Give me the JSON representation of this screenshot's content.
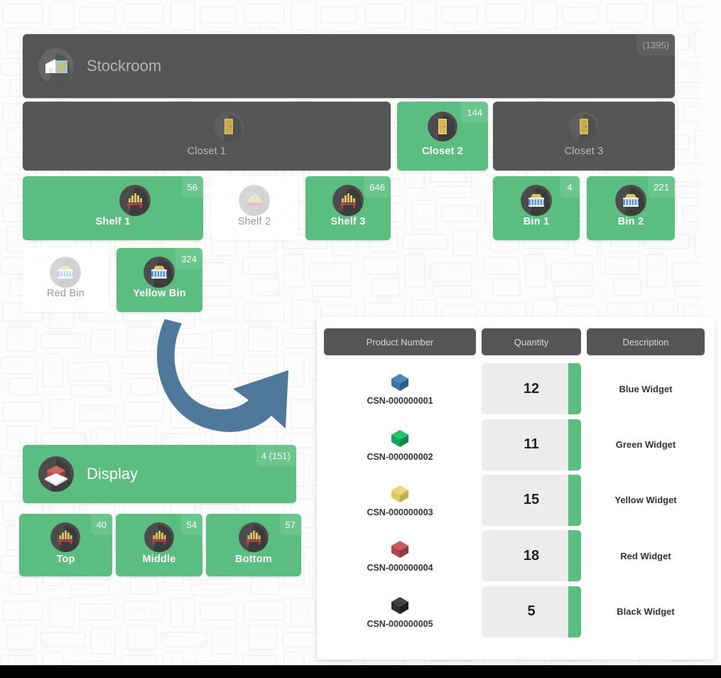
{
  "background": {
    "texture": "light-brick-pattern",
    "base_color": "#fcfcfc"
  },
  "colors": {
    "green": "#5cbd81",
    "green_badge": "#6ac68d",
    "dark": "#555555",
    "dark_badge": "#5f5f5f",
    "panel_white": "#ffffff",
    "qty_cell": "#ececec",
    "arrow_blue": "#4f7fa0"
  },
  "stockroom": {
    "title": "Stockroom",
    "badge": "(1395)",
    "icon": "warehouse-icon",
    "state": "inactive"
  },
  "closets": [
    {
      "label": "Closet 1",
      "badge": "",
      "icon": "closet-door-icon",
      "state": "inactive"
    },
    {
      "label": "Closet 2",
      "badge": "144",
      "icon": "closet-door-icon",
      "state": "active"
    },
    {
      "label": "Closet 3",
      "badge": "",
      "icon": "closet-door-icon",
      "state": "inactive"
    }
  ],
  "shelves": [
    {
      "label": "Shelf 1",
      "badge": "56",
      "icon": "shelf-icon",
      "state": "active"
    },
    {
      "label": "Shelf 2",
      "badge": "",
      "icon": "shelf-icon",
      "state": "empty"
    },
    {
      "label": "Shelf 3",
      "badge": "646",
      "icon": "shelf-icon",
      "state": "active"
    }
  ],
  "bins_top": [
    {
      "label": "Bin 1",
      "badge": "4",
      "icon": "bin-icon",
      "state": "active"
    },
    {
      "label": "Bin 2",
      "badge": "221",
      "icon": "bin-icon",
      "state": "active"
    }
  ],
  "bins_bottom": [
    {
      "label": "Red Bin",
      "badge": "",
      "icon": "bin-icon",
      "state": "empty"
    },
    {
      "label": "Yellow Bin",
      "badge": "324",
      "icon": "bin-icon",
      "state": "active"
    }
  ],
  "display": {
    "title": "Display",
    "badge": "4 (151)",
    "icon": "open-box-icon",
    "state": "active",
    "shelves": [
      {
        "label": "Top",
        "badge": "40",
        "icon": "shelf-icon",
        "state": "active"
      },
      {
        "label": "Middle",
        "badge": "54",
        "icon": "shelf-icon",
        "state": "active"
      },
      {
        "label": "Bottom",
        "badge": "57",
        "icon": "shelf-icon",
        "state": "active"
      }
    ]
  },
  "arrow": {
    "icon": "curved-arrow-icon",
    "direction": "down-right"
  },
  "table": {
    "columns": [
      "Product Number",
      "Quantity",
      "Description"
    ],
    "rows": [
      {
        "product_number": "CSN-000000001",
        "quantity": "12",
        "description": "Blue Widget",
        "icon": "hex-widget-icon",
        "color": "#3b72a8"
      },
      {
        "product_number": "CSN-000000002",
        "quantity": "11",
        "description": "Green Widget",
        "icon": "hex-widget-icon",
        "color": "#18a85a"
      },
      {
        "product_number": "CSN-000000003",
        "quantity": "15",
        "description": "Yellow Widget",
        "icon": "hex-widget-icon",
        "color": "#ddc95f"
      },
      {
        "product_number": "CSN-000000004",
        "quantity": "18",
        "description": "Red Widget",
        "icon": "hex-widget-icon",
        "color": "#b1454c"
      },
      {
        "product_number": "CSN-000000005",
        "quantity": "5",
        "description": "Black Widget",
        "icon": "hex-widget-icon",
        "color": "#2f2f2f"
      }
    ]
  }
}
